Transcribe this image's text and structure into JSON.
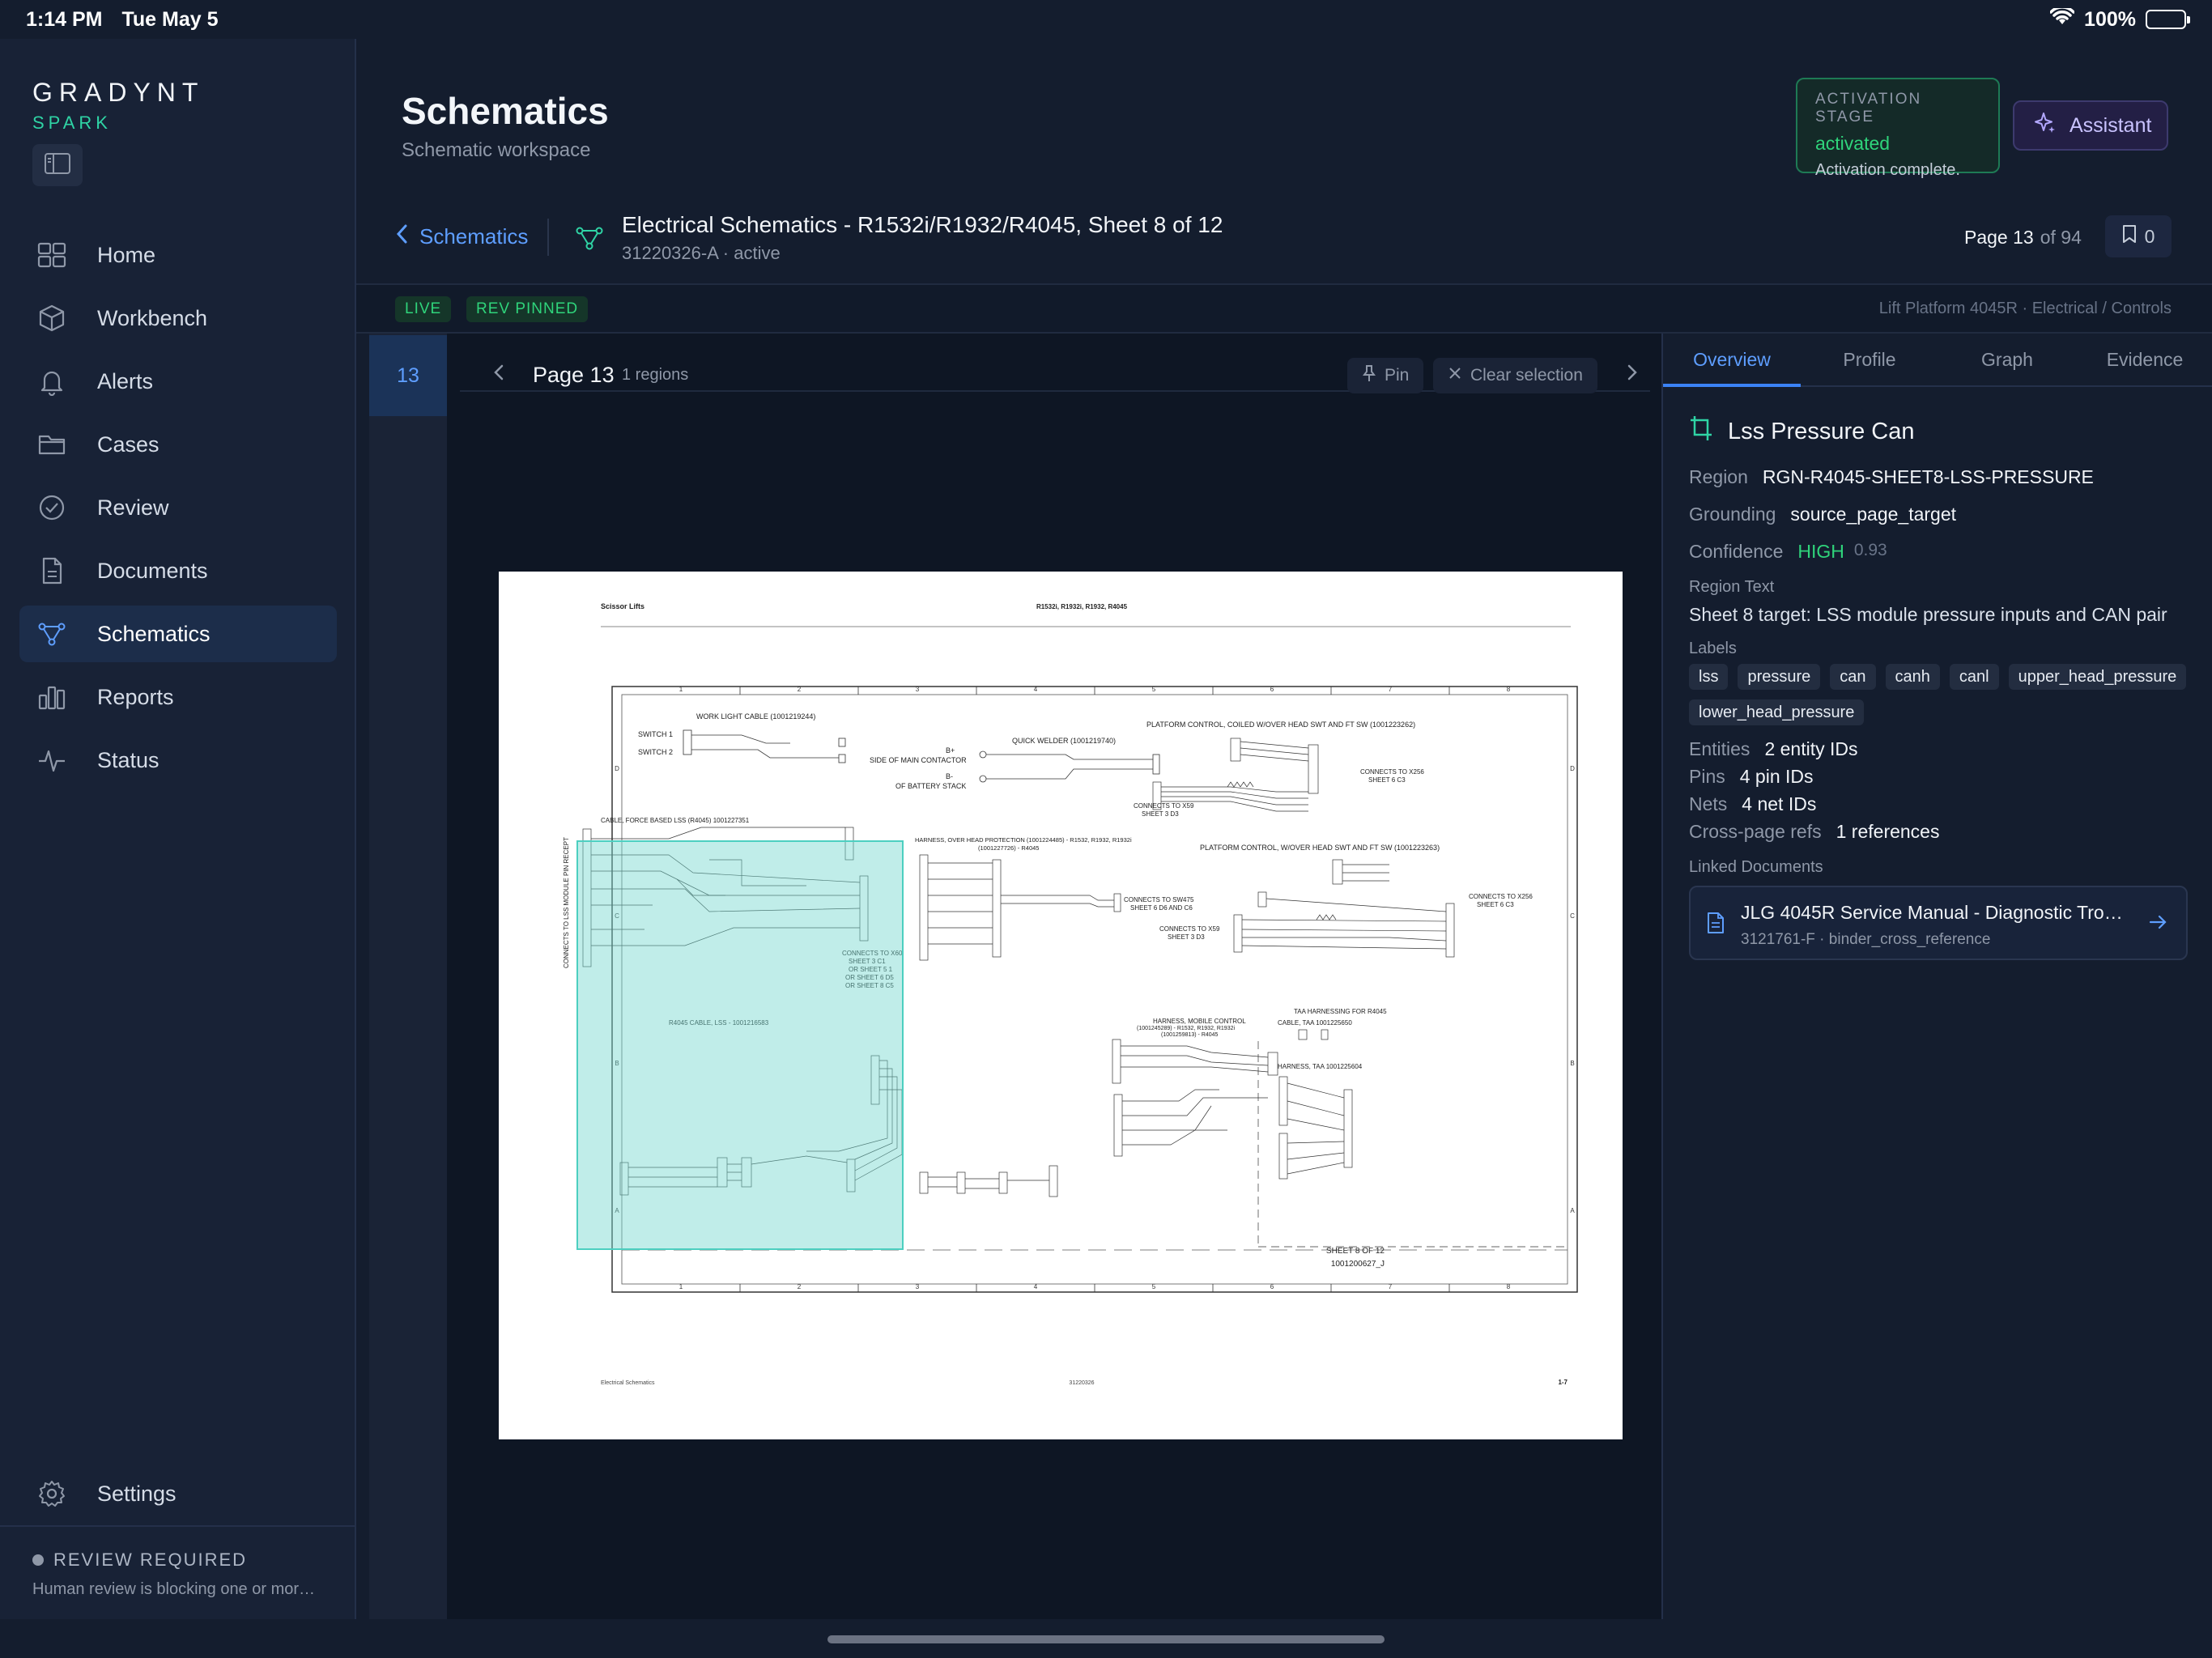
{
  "status_bar": {
    "time": "1:14 PM",
    "date": "Tue May 5",
    "battery": "100%"
  },
  "brand": {
    "name": "GRADYNT",
    "product": "SPARK"
  },
  "sidebar": {
    "items": [
      {
        "label": "Home",
        "icon": "grid-icon"
      },
      {
        "label": "Workbench",
        "icon": "cube-icon"
      },
      {
        "label": "Alerts",
        "icon": "bell-icon"
      },
      {
        "label": "Cases",
        "icon": "folder-icon"
      },
      {
        "label": "Review",
        "icon": "check-circle-icon"
      },
      {
        "label": "Documents",
        "icon": "document-icon"
      },
      {
        "label": "Schematics",
        "icon": "schematic-icon",
        "active": true
      },
      {
        "label": "Reports",
        "icon": "bar-chart-icon"
      },
      {
        "label": "Status",
        "icon": "pulse-icon"
      }
    ],
    "settings_label": "Settings",
    "review": {
      "title": "REVIEW REQUIRED",
      "subtitle": "Human review is blocking one or mor…"
    }
  },
  "header": {
    "title": "Schematics",
    "subtitle": "Schematic workspace",
    "activation": {
      "label": "ACTIVATION STAGE",
      "value": "activated",
      "detail": "Activation complete."
    },
    "assistant_label": "Assistant"
  },
  "document": {
    "back_label": "Schematics",
    "title": "Electrical Schematics - R1532i/R1932/R4045, Sheet 8 of 12",
    "meta": "31220326-A · active",
    "page_label": "Page 13",
    "page_total": "of 94",
    "bookmark_count": "0",
    "pills": [
      "LIVE",
      "REV PINNED"
    ],
    "context": "Lift Platform 4045R · Electrical / Controls"
  },
  "thumbnails": {
    "current": "13"
  },
  "viewer": {
    "page": "Page 13",
    "regions": "1 regions",
    "pin_label": "Pin",
    "clear_label": "Clear selection"
  },
  "sheet": {
    "header_left": "Scissor Lifts",
    "header_center": "R1532i, R1932i, R1932, R4045",
    "col_numbers": [
      "1",
      "2",
      "3",
      "4",
      "5",
      "6",
      "7",
      "8"
    ],
    "row_letters": [
      "D",
      "C",
      "B",
      "A"
    ],
    "labels": {
      "work_light": "WORK LIGHT CABLE (1001219244)",
      "switch1": "SWITCH 1",
      "switch2": "SWITCH 2",
      "quick_welder": "QUICK WELDER (1001219740)",
      "b_plus": "B+",
      "side_contactor": "SIDE OF MAIN CONTACTOR",
      "b_minus": "B-",
      "battery_stack": "OF BATTERY STACK",
      "platform_coiled": "PLATFORM CONTROL, COILED W/OVER HEAD SWT AND FT SW (1001223262)",
      "connects_x59": "CONNECTS TO X59",
      "sheet3_d3": "SHEET 3 D3",
      "connects_x256": "CONNECTS TO X256",
      "sheet6_c3": "SHEET 6 C3",
      "cable_force": "CABLE, FORCE BASED LSS (R4045) 1001227351",
      "harness_overhead": "HARNESS, OVER HEAD PROTECTION (1001224485) - R1532, R1932, R1932i",
      "harness_overhead2": "(1001227726) - R4045",
      "platform_wover": "PLATFORM CONTROL, W/OVER HEAD SWT AND FT SW (1001223263)",
      "connects_sw475": "CONNECTS TO SW475",
      "sheet6_d6": "SHEET 6 D6 AND C6",
      "connects_x59_b": "CONNECTS TO X59",
      "sheet3_d3_b": "SHEET 3 D3",
      "connects_x256_b": "CONNECTS TO X256",
      "sheet6_c3_b": "SHEET 6 C3",
      "connects_x60": "CONNECTS TO X60",
      "sheet3_c1": "SHEET 3 C1",
      "sheet5_1": "OR SHEET 5 1",
      "sheet6_d5": "OR SHEET 6 D5",
      "sheet8_c5": "OR SHEET 8 C5",
      "lss_module": "CONNECTS TO LSS MODULE PIN RECEPT",
      "r4045_cable": "R4045 CABLE, LSS - 1001216583",
      "harness_mobile": "HARNESS, MOBILE CONTROL",
      "harness_mobile2": "(1001245289) - R1532, R1932, R1932i",
      "harness_mobile3": "(1001259813) - R4045",
      "taa_harnessing": "TAA HARNESSING FOR R4045",
      "cable_taa": "CABLE, TAA 1001225650",
      "harness_taa": "HARNESS, TAA 1001225604",
      "sheet_num": "SHEET 8 OF 12",
      "drawing_num": "1001200627_J",
      "footer_left": "Electrical Schematics",
      "footer_center": "31220326",
      "footer_right": "1-7"
    }
  },
  "panel": {
    "tabs": [
      "Overview",
      "Profile",
      "Graph",
      "Evidence"
    ],
    "active_tab": "Overview",
    "title": "Lss Pressure Can",
    "region_key": "Region",
    "region_val": "RGN-R4045-SHEET8-LSS-PRESSURE",
    "grounding_key": "Grounding",
    "grounding_val": "source_page_target",
    "confidence_key": "Confidence",
    "confidence_val": "HIGH",
    "confidence_score": "0.93",
    "region_text_label": "Region Text",
    "region_text": "Sheet 8 target: LSS module pressure inputs and CAN pair",
    "labels_label": "Labels",
    "labels": [
      "lss",
      "pressure",
      "can",
      "canh",
      "canl",
      "upper_head_pressure",
      "lower_head_pressure"
    ],
    "entities_key": "Entities",
    "entities_val": "2 entity IDs",
    "pins_key": "Pins",
    "pins_val": "4 pin IDs",
    "nets_key": "Nets",
    "nets_val": "4 net IDs",
    "xref_key": "Cross-page refs",
    "xref_val": "1 references",
    "linked_label": "Linked Documents",
    "linked_title": "JLG 4045R Service Manual - Diagnostic Tro…",
    "linked_meta": "3121761-F · binder_cross_reference"
  },
  "colors": {
    "accent": "#3b82f6",
    "success": "#2fd47b",
    "brand": "#2fd4a5",
    "highlight": "#74d8cf"
  }
}
